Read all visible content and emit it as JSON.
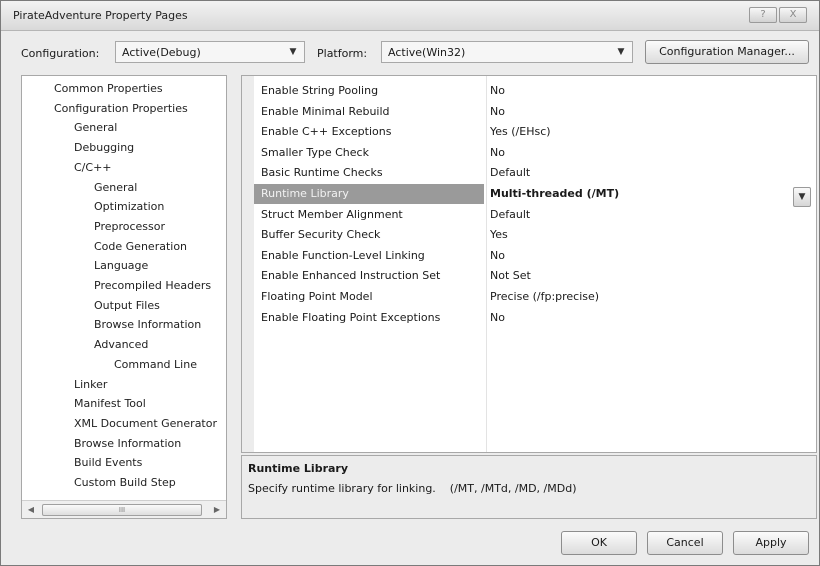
{
  "window": {
    "title": "PirateAdventure Property Pages",
    "help_label": "?",
    "close_label": "X"
  },
  "toolbar": {
    "configuration_label": "Configuration:",
    "configuration_value": "Active(Debug)",
    "platform_label": "Platform:",
    "platform_value": "Active(Win32)",
    "config_manager_label": "Configuration Manager..."
  },
  "tree": {
    "items": [
      {
        "label": "Common Properties",
        "level": 0
      },
      {
        "label": "Configuration Properties",
        "level": 0
      },
      {
        "label": "General",
        "level": 1
      },
      {
        "label": "Debugging",
        "level": 1
      },
      {
        "label": "C/C++",
        "level": 1
      },
      {
        "label": "General",
        "level": 2
      },
      {
        "label": "Optimization",
        "level": 2
      },
      {
        "label": "Preprocessor",
        "level": 2
      },
      {
        "label": "Code Generation",
        "level": 2
      },
      {
        "label": "Language",
        "level": 2
      },
      {
        "label": "Precompiled Headers",
        "level": 2
      },
      {
        "label": "Output Files",
        "level": 2
      },
      {
        "label": "Browse Information",
        "level": 2
      },
      {
        "label": "Advanced",
        "level": 2
      },
      {
        "label": "Command Line",
        "level": 3
      },
      {
        "label": "Linker",
        "level": 1
      },
      {
        "label": "Manifest Tool",
        "level": 1
      },
      {
        "label": "XML Document Generator",
        "level": 1
      },
      {
        "label": "Browse Information",
        "level": 1
      },
      {
        "label": "Build Events",
        "level": 1
      },
      {
        "label": "Custom Build Step",
        "level": 1
      }
    ],
    "scroll_thumb_label": "III"
  },
  "properties": [
    {
      "name": "Enable String Pooling",
      "value": "No"
    },
    {
      "name": "Enable Minimal Rebuild",
      "value": "No"
    },
    {
      "name": "Enable C++ Exceptions",
      "value": "Yes (/EHsc)"
    },
    {
      "name": "Smaller Type Check",
      "value": "No"
    },
    {
      "name": "Basic Runtime Checks",
      "value": "Default"
    },
    {
      "name": "Runtime Library",
      "value": "Multi-threaded (/MT)",
      "selected": true
    },
    {
      "name": "Struct Member Alignment",
      "value": "Default"
    },
    {
      "name": "Buffer Security Check",
      "value": "Yes"
    },
    {
      "name": "Enable Function-Level Linking",
      "value": "No"
    },
    {
      "name": "Enable Enhanced Instruction Set",
      "value": "Not Set"
    },
    {
      "name": "Floating Point Model",
      "value": "Precise (/fp:precise)"
    },
    {
      "name": "Enable Floating Point Exceptions",
      "value": "No"
    }
  ],
  "description": {
    "title": "Runtime Library",
    "text": "Specify runtime library for linking.    (/MT, /MTd, /MD, /MDd)"
  },
  "buttons": {
    "ok": "OK",
    "cancel": "Cancel",
    "apply": "Apply"
  }
}
